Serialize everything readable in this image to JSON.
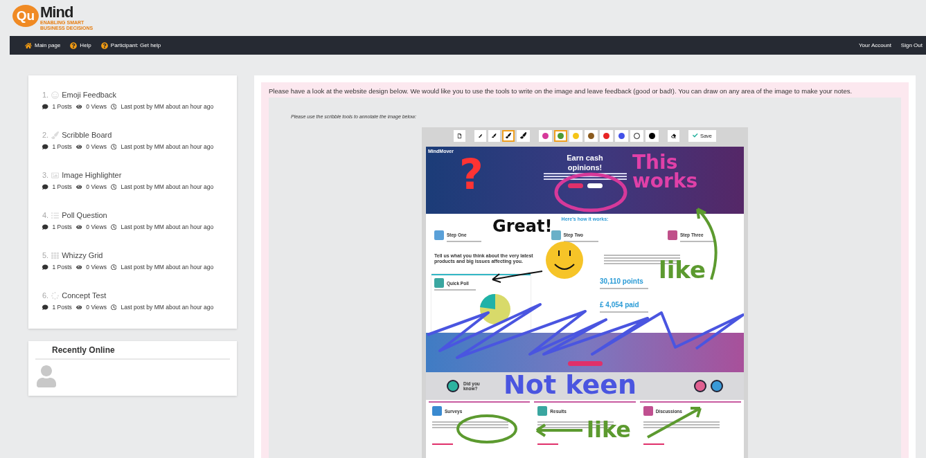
{
  "logo": {
    "name_a": "Qu",
    "name_b": "Mind",
    "tagline": "ENABLING SMART BUSINESS DECISIONS"
  },
  "nav": {
    "left": [
      {
        "label": "Main page",
        "kind": "home"
      },
      {
        "label": "Help",
        "kind": "help"
      },
      {
        "label": "Participant: Get help",
        "kind": "help"
      }
    ],
    "right": [
      "Your Account",
      "Sign Out"
    ]
  },
  "activities": [
    {
      "number": "1.",
      "title": "Emoji Feedback",
      "kind": "emoji",
      "posts": "1 Posts",
      "views": "0 Views",
      "last_post": "Last post by MM about an hour ago"
    },
    {
      "number": "2.",
      "title": "Scribble Board",
      "kind": "brush",
      "posts": "1 Posts",
      "views": "0 Views",
      "last_post": "Last post by MM about an hour ago"
    },
    {
      "number": "3.",
      "title": "Image Highlighter",
      "kind": "image",
      "posts": "1 Posts",
      "views": "0 Views",
      "last_post": "Last post by MM about an hour ago"
    },
    {
      "number": "4.",
      "title": "Poll Question",
      "kind": "list",
      "posts": "1 Posts",
      "views": "0 Views",
      "last_post": "Last post by MM about an hour ago"
    },
    {
      "number": "5.",
      "title": "Whizzy Grid",
      "kind": "grid",
      "posts": "1 Posts",
      "views": "0 Views",
      "last_post": "Last post by MM about an hour ago"
    },
    {
      "number": "6.",
      "title": "Concept Test",
      "kind": "spinner",
      "posts": "1 Posts",
      "views": "0 Views",
      "last_post": "Last post by MM about an hour ago"
    }
  ],
  "recently_online": {
    "title": "Recently Online"
  },
  "main": {
    "intro": "Please have a look at the website design below. We would like you to use the tools to write on the image and leave feedback (good or bad!). You can draw on any area of the image to make your notes.",
    "note": "Please use the scribble tools to annotate the image below:"
  },
  "toolbar": {
    "sizes": [
      {
        "selected": false
      },
      {
        "selected": false
      },
      {
        "selected": true
      },
      {
        "selected": false
      }
    ],
    "colors": [
      {
        "color": "#d6399a",
        "selected": false
      },
      {
        "color": "#4c9a35",
        "selected": true
      },
      {
        "color": "#f5c518",
        "selected": false
      },
      {
        "color": "#8a5a1e",
        "selected": false
      },
      {
        "color": "#e82424",
        "selected": false
      },
      {
        "color": "#4150e8",
        "selected": false
      },
      {
        "color": "#ffffff",
        "selected": false
      },
      {
        "color": "#000000",
        "selected": false
      }
    ],
    "save": "Save"
  },
  "design": {
    "brand": "MindMover",
    "hero_title_1": "Earn cash",
    "hero_title_2": "opinions!",
    "how_it_works": "Here's how it works:",
    "steps": [
      {
        "title": "Step One"
      },
      {
        "title": "Step Two"
      },
      {
        "title": "Step Three"
      }
    ],
    "tell_us": "Tell us what you think about the very latest products and big issues affecting you.",
    "poll_title": "Quick Poll",
    "stats": [
      {
        "value": "30,110 points"
      },
      {
        "value": "£ 4,054 paid"
      }
    ],
    "did_you_know": "Did you know?",
    "cards": [
      {
        "title": "Surveys"
      },
      {
        "title": "Results"
      },
      {
        "title": "Discussions"
      }
    ]
  },
  "annotations": [
    {
      "text": "?",
      "color": "#ff3333"
    },
    {
      "text": "This works",
      "color": "#e040a8"
    },
    {
      "text": "Great!",
      "color": "#111111"
    },
    {
      "text": "like",
      "color": "#5c9a2f"
    },
    {
      "text": "Not keen",
      "color": "#4a55e0"
    },
    {
      "text": "like",
      "color": "#5c9a2f"
    }
  ]
}
